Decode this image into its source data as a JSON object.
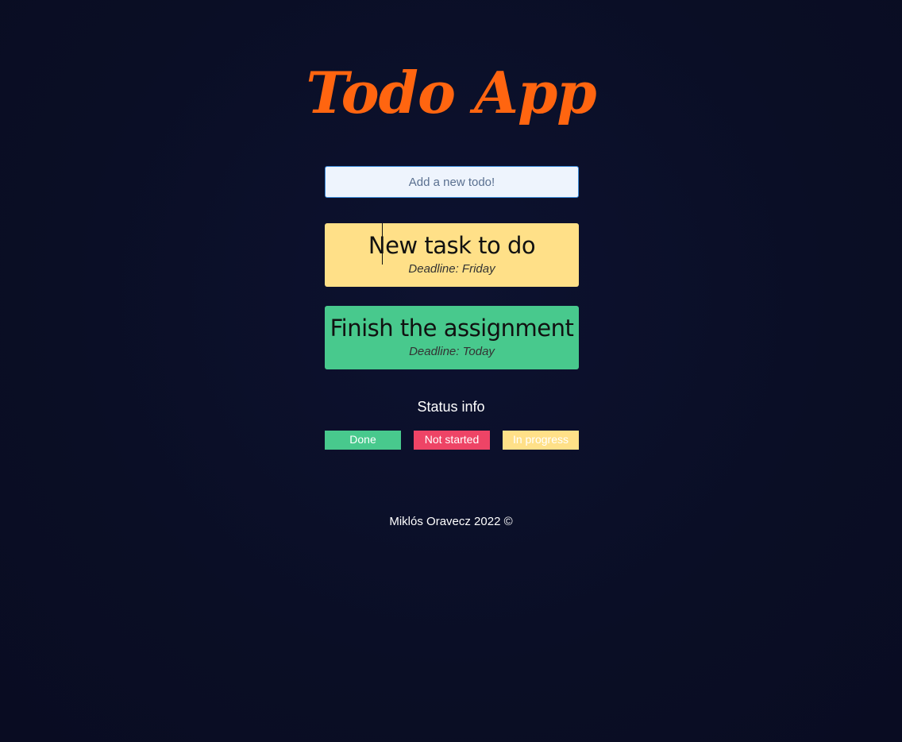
{
  "app": {
    "title": "Todo App"
  },
  "new_todo": {
    "placeholder": "Add a new todo!",
    "value": ""
  },
  "todos": [
    {
      "text": "New task to do",
      "deadline": "Deadline: Friday",
      "status": "in-progress"
    },
    {
      "text": "Finish the assignment",
      "deadline": "Deadline: Today",
      "status": "done"
    }
  ],
  "status_info": {
    "heading": "Status info",
    "legend": [
      {
        "label": "Done",
        "color": "#48c98d"
      },
      {
        "label": "Not started",
        "color": "#ee4466"
      },
      {
        "label": "In progress",
        "color": "#ffe088"
      }
    ]
  },
  "footer": {
    "text": "Miklós Oravecz 2022 ©"
  },
  "colors": {
    "background": "#0b0f26",
    "title": "#ff6510",
    "in_progress": "#ffe088",
    "done": "#48c98d",
    "not_started": "#ee4466"
  }
}
